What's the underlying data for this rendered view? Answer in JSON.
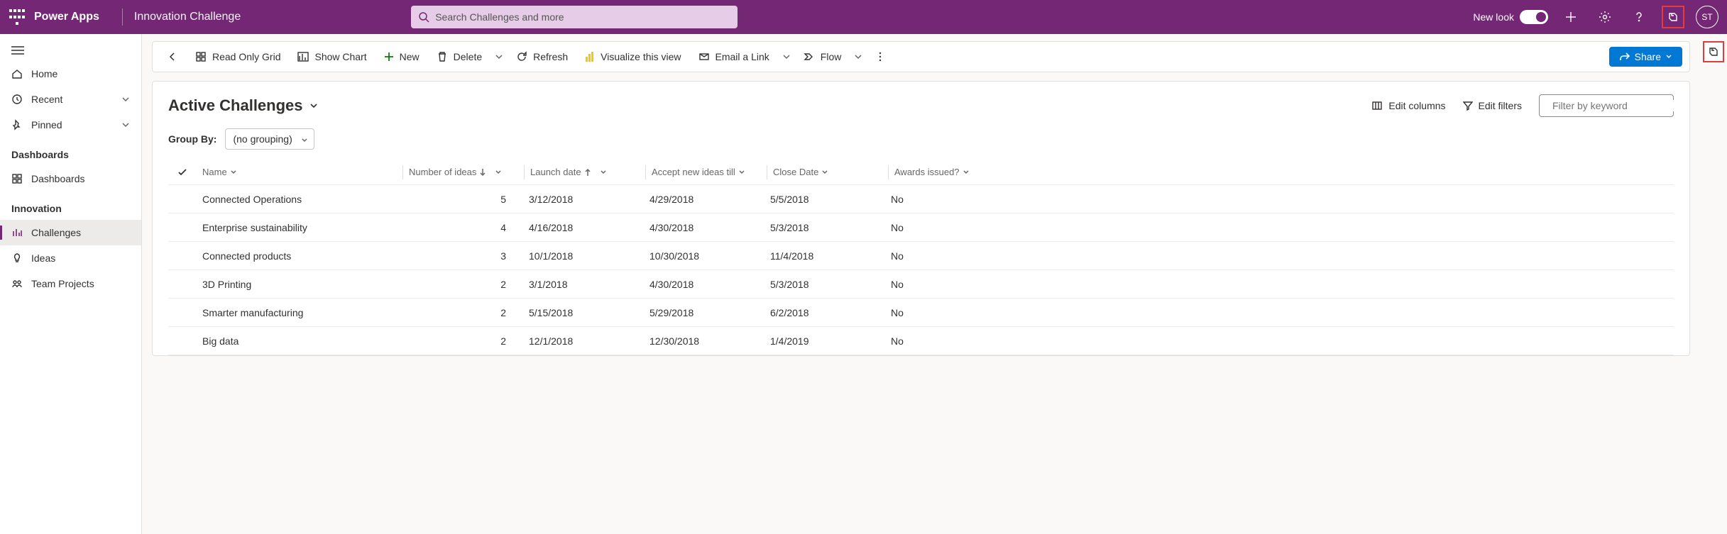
{
  "topbar": {
    "app_name": "Power Apps",
    "app_sub": "Innovation Challenge",
    "search_placeholder": "Search Challenges and more",
    "new_look": "New look",
    "avatar": "ST"
  },
  "sidebar": {
    "home": "Home",
    "recent": "Recent",
    "pinned": "Pinned",
    "dashboards_heading": "Dashboards",
    "dashboards": "Dashboards",
    "innovation_heading": "Innovation",
    "challenges": "Challenges",
    "ideas": "Ideas",
    "team_projects": "Team Projects"
  },
  "cmdbar": {
    "grid": "Read Only Grid",
    "show_chart": "Show Chart",
    "new": "New",
    "delete": "Delete",
    "refresh": "Refresh",
    "visualize": "Visualize this view",
    "email": "Email a Link",
    "flow": "Flow",
    "share": "Share"
  },
  "view": {
    "title": "Active Challenges",
    "edit_columns": "Edit columns",
    "edit_filters": "Edit filters",
    "filter_placeholder": "Filter by keyword",
    "group_by_label": "Group By:",
    "group_by_value": "(no grouping)"
  },
  "columns": {
    "name": "Name",
    "ideas": "Number of ideas",
    "launch": "Launch date",
    "accept": "Accept new ideas till",
    "close": "Close Date",
    "awards": "Awards issued?"
  },
  "rows": [
    {
      "name": "Connected Operations",
      "ideas": "5",
      "launch": "3/12/2018",
      "accept": "4/29/2018",
      "close": "5/5/2018",
      "awards": "No"
    },
    {
      "name": "Enterprise sustainability",
      "ideas": "4",
      "launch": "4/16/2018",
      "accept": "4/30/2018",
      "close": "5/3/2018",
      "awards": "No"
    },
    {
      "name": "Connected products",
      "ideas": "3",
      "launch": "10/1/2018",
      "accept": "10/30/2018",
      "close": "11/4/2018",
      "awards": "No"
    },
    {
      "name": "3D Printing",
      "ideas": "2",
      "launch": "3/1/2018",
      "accept": "4/30/2018",
      "close": "5/3/2018",
      "awards": "No"
    },
    {
      "name": "Smarter manufacturing",
      "ideas": "2",
      "launch": "5/15/2018",
      "accept": "5/29/2018",
      "close": "6/2/2018",
      "awards": "No"
    },
    {
      "name": "Big data",
      "ideas": "2",
      "launch": "12/1/2018",
      "accept": "12/30/2018",
      "close": "1/4/2019",
      "awards": "No"
    }
  ]
}
